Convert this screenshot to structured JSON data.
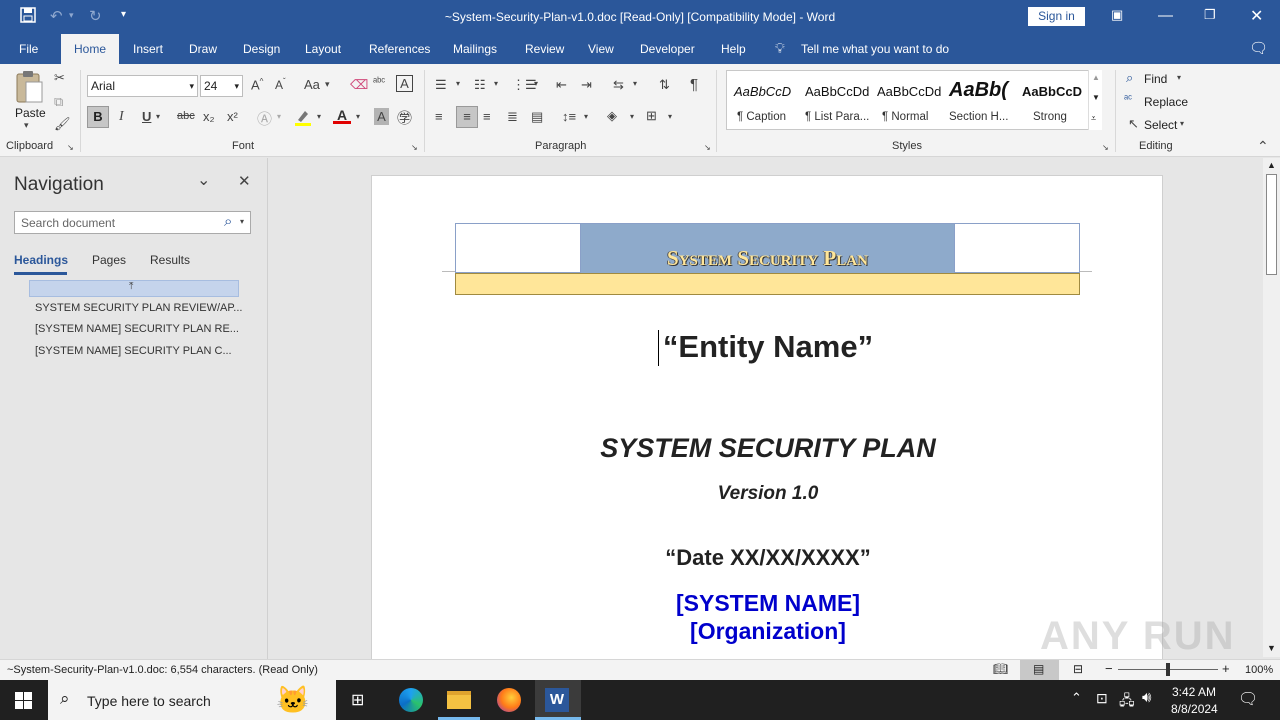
{
  "titlebar": {
    "title": "~System-Security-Plan-v1.0.doc [Read-Only] [Compatibility Mode]  -  Word",
    "signin": "Sign in"
  },
  "tabs": [
    "File",
    "Home",
    "Insert",
    "Draw",
    "Design",
    "Layout",
    "References",
    "Mailings",
    "Review",
    "View",
    "Developer",
    "Help"
  ],
  "tellme": "Tell me what you want to do",
  "ribbon": {
    "clipboard": {
      "paste": "Paste",
      "label": "Clipboard"
    },
    "font": {
      "family": "Arial",
      "size": "24",
      "label": "Font",
      "bold": "B",
      "italic": "I",
      "underline": "U",
      "strike": "abc",
      "sub": "x₂",
      "sup": "x²",
      "case": "Aa"
    },
    "paragraph": {
      "label": "Paragraph"
    },
    "styles": {
      "label": "Styles",
      "items": [
        {
          "sample": "AaBbCcD",
          "name": "¶ Caption"
        },
        {
          "sample": "AaBbCcDd",
          "name": "¶ List Para..."
        },
        {
          "sample": "AaBbCcDd",
          "name": "¶ Normal"
        },
        {
          "sample": "AaBb(",
          "name": "Section H..."
        },
        {
          "sample": "AaBbCcD",
          "name": "Strong"
        }
      ]
    },
    "editing": {
      "label": "Editing",
      "find": "Find",
      "replace": "Replace",
      "select": "Select"
    }
  },
  "nav": {
    "title": "Navigation",
    "search_placeholder": "Search document",
    "tabs": [
      "Headings",
      "Pages",
      "Results"
    ],
    "headings": [
      "SYSTEM SECURITY PLAN REVIEW/AP...",
      "[SYSTEM NAME] SECURITY PLAN RE...",
      "[SYSTEM NAME] SECURITY PLAN C..."
    ]
  },
  "document": {
    "banner": "System Security Plan",
    "entity": "“Entity Name”",
    "title": "SYSTEM SECURITY PLAN",
    "version": "Version 1.0",
    "date": "“Date XX/XX/XXXX”",
    "system_name": "[SYSTEM NAME]",
    "organization": "[Organization]"
  },
  "status": {
    "left": "~System-Security-Plan-v1.0.doc: 6,554 characters.  (Read Only)",
    "zoom": "100%"
  },
  "taskbar": {
    "search_placeholder": "Type here to search",
    "time": "3:42 AM",
    "date": "8/8/2024"
  },
  "watermark": "ANY RUN",
  "colors": {
    "word_blue": "#2b579a",
    "banner_blue": "#8eaacb",
    "banner_yellow": "#ffe699",
    "doc_link_blue": "#0000cc"
  }
}
